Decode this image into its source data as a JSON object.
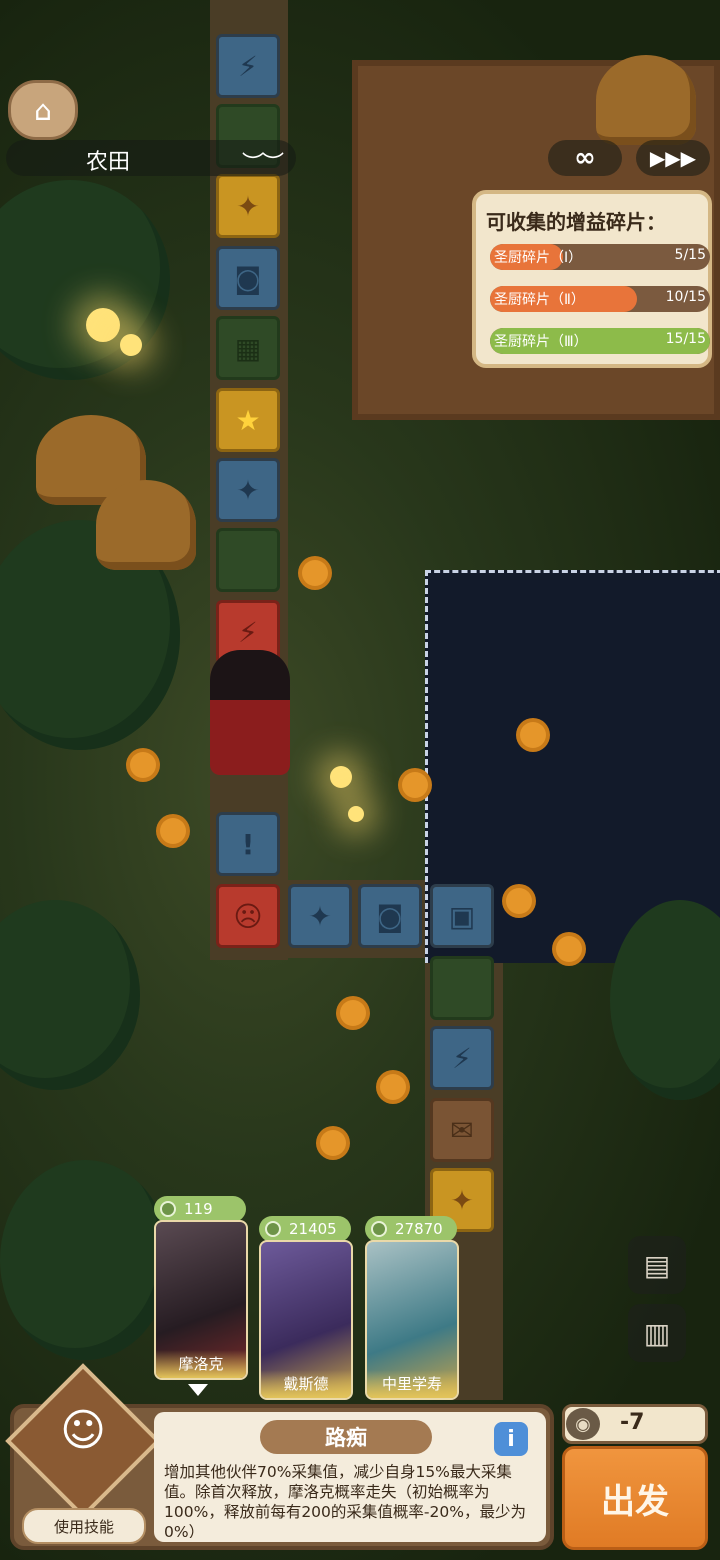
{
  "location": {
    "name": "农田"
  },
  "controls": {
    "loop": "∞",
    "speed": "▶▶▶"
  },
  "buff_panel": {
    "title": "可收集的增益碎片：",
    "items": [
      {
        "label": "圣厨碎片（Ⅰ）",
        "count": "5/15",
        "progress": 0.33,
        "color": "#e8743a"
      },
      {
        "label": "圣厨碎片（Ⅱ）",
        "count": "10/15",
        "progress": 0.67,
        "color": "#e8743a"
      },
      {
        "label": "圣厨碎片（Ⅲ）",
        "count": "15/15",
        "progress": 1.0,
        "color": "#8dbb4a"
      }
    ]
  },
  "party": [
    {
      "name": "摩洛克",
      "value": "119"
    },
    {
      "name": "戴斯德",
      "value": "21405"
    },
    {
      "name": "中里学寿",
      "value": "27870"
    }
  ],
  "skill": {
    "use_label": "使用技能",
    "title": "路痴",
    "description": "增加其他伙伴70%采集值，减少自身15%最大采集值。除首次释放，摩洛克概率走失（初始概率为100%，释放前每有200的采集值概率-20%，最少为0%）"
  },
  "cost": {
    "value": "-7"
  },
  "go_button": {
    "label": "出发"
  },
  "icons": {
    "home": "home-icon",
    "eye": "eye-closed-icon",
    "info": "info-icon",
    "gallery": "gallery-icon",
    "backpack": "backpack-icon"
  }
}
